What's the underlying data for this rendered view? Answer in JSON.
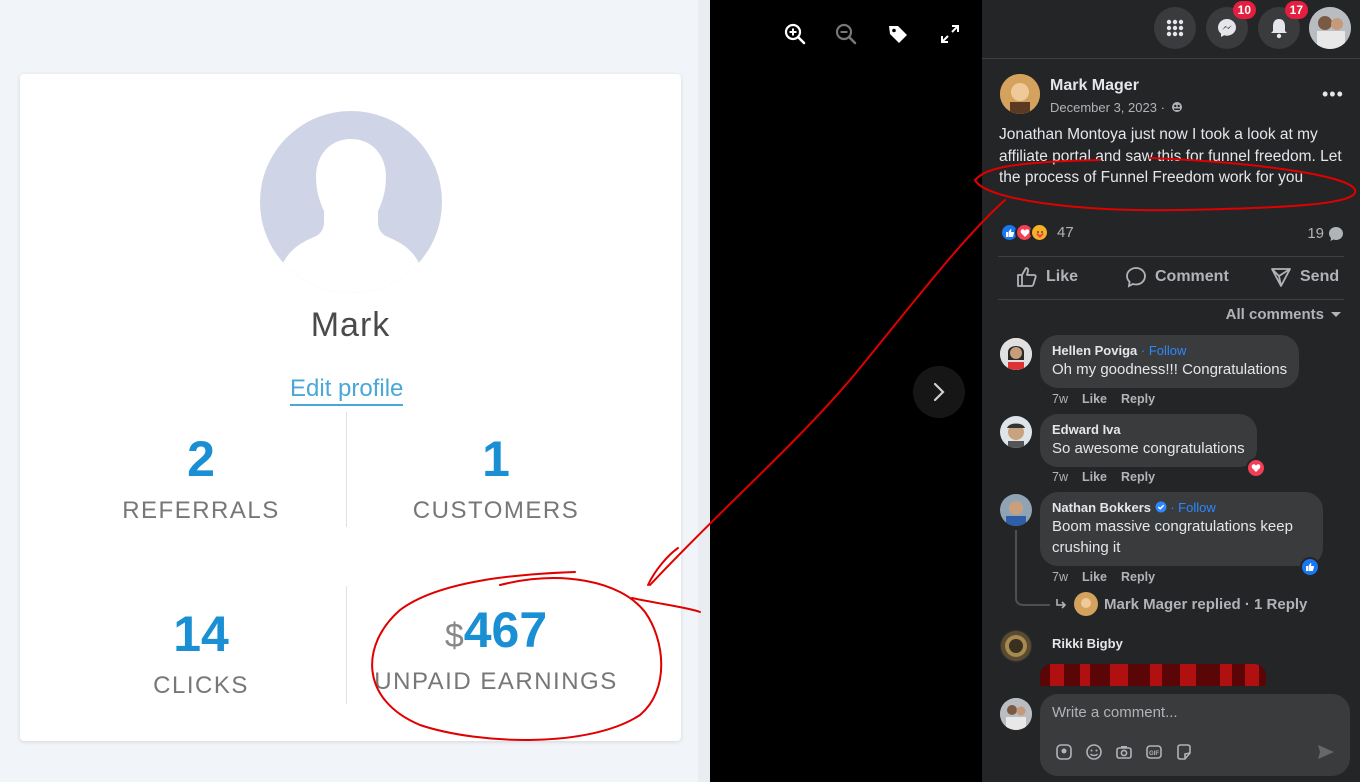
{
  "affiliate": {
    "name": "Mark",
    "edit_profile": "Edit profile",
    "stats": [
      {
        "value": "2",
        "label": "REFERRALS"
      },
      {
        "value": "1",
        "label": "CUSTOMERS"
      },
      {
        "value": "14",
        "label": "CLICKS"
      },
      {
        "currency": "$",
        "value": "467",
        "label": "UNPAID EARNINGS"
      }
    ]
  },
  "photo_toolbar": {
    "icons": [
      "zoom-in-icon",
      "zoom-out-icon",
      "tag-icon",
      "fullscreen-icon"
    ]
  },
  "topbar": {
    "messenger_badge": "10",
    "notifications_badge": "17"
  },
  "post": {
    "author": "Mark Mager",
    "date": "December 3, 2023 ·",
    "text": "Jonathan Montoya just now I took a look at my affiliate portal and saw this for funnel freedom. Let the process of Funnel Freedom work for you",
    "reaction_count": "47",
    "comment_count": "19",
    "actions": {
      "like": "Like",
      "comment": "Comment",
      "send": "Send"
    },
    "all_comments": "All comments"
  },
  "comments": [
    {
      "name": "Hellen Poviga",
      "follow": "· Follow",
      "text": "Oh my goodness!!! Congratulations",
      "time": "7w",
      "like": "Like",
      "reply": "Reply"
    },
    {
      "name": "Edward Iva",
      "text": "So awesome congratulations",
      "time": "7w",
      "like": "Like",
      "reply": "Reply"
    },
    {
      "name": "Nathan Bokkers",
      "follow": "· Follow",
      "text": "Boom massive congratulations keep crushing it",
      "time": "7w",
      "like": "Like",
      "reply": "Reply",
      "replied": "Mark Mager replied · 1 Reply"
    },
    {
      "name": "Rikki Bigby"
    }
  ],
  "composer": {
    "placeholder": "Write a comment..."
  },
  "colors": {
    "accent_blue": "#1a8fd4",
    "fb_dark": "#242526",
    "annotation_red": "#e00000"
  }
}
